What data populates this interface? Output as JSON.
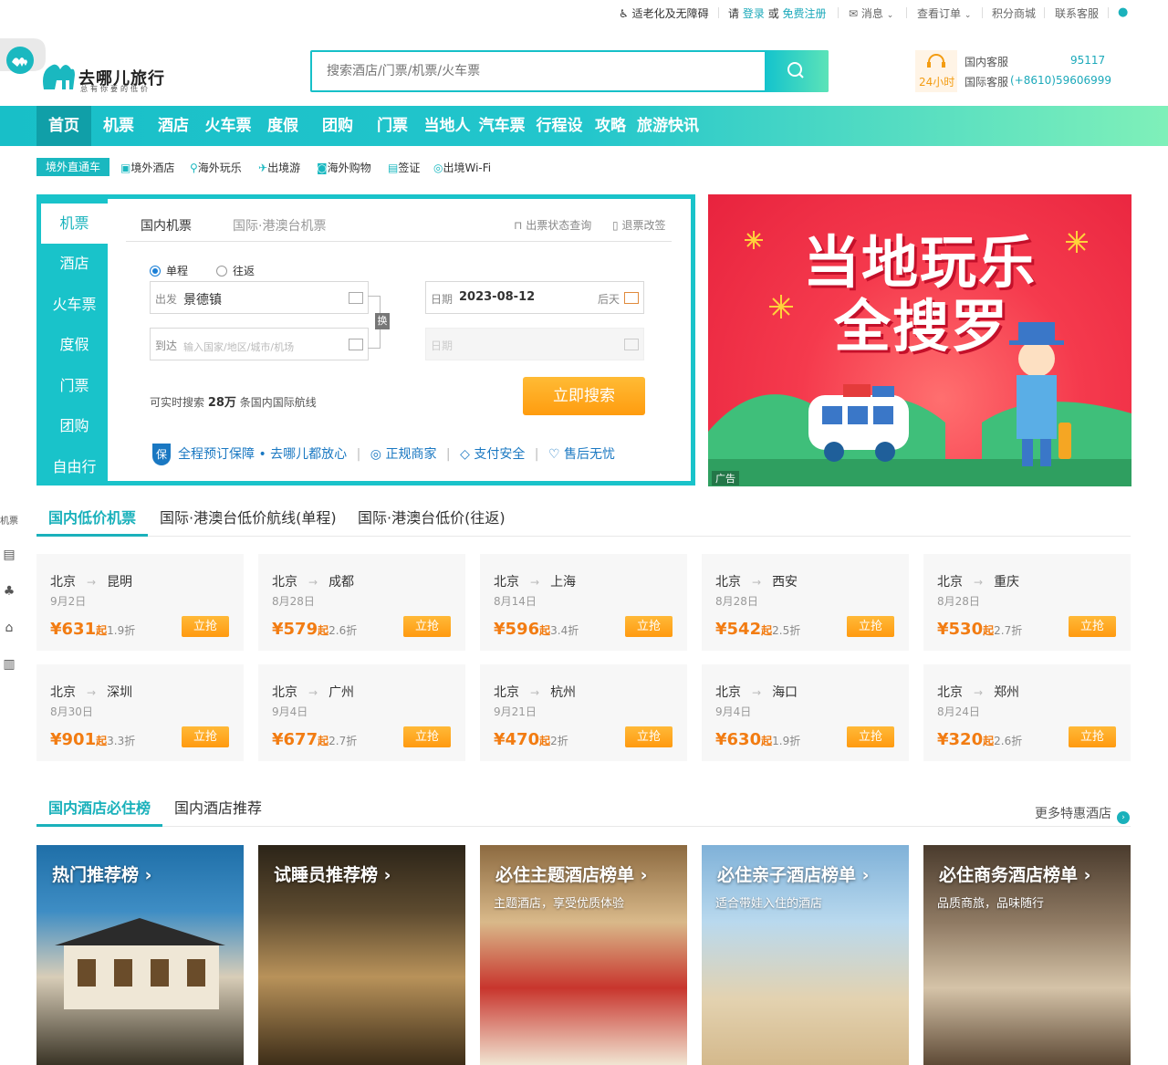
{
  "topbar": {
    "accessibility": "适老化及无障碍",
    "please": "请",
    "login": "登录",
    "or": "或",
    "register": "免费注册",
    "messages": "消息",
    "orders": "查看订单",
    "points_mall": "积分商城",
    "contact": "联系客服"
  },
  "header": {
    "logo_name": "去哪儿旅行",
    "logo_slogan": "总有你要的低价",
    "search_placeholder": "搜索酒店/门票/机票/火车票",
    "service_24h": "24小时",
    "domestic_label": "国内客服",
    "domestic_number": "95117",
    "intl_label": "国际客服",
    "intl_number": "(+8610)59606999"
  },
  "nav": [
    "首页",
    "机票",
    "酒店",
    "火车票",
    "度假",
    "团购",
    "门票",
    "当地人",
    "汽车票",
    "行程设计",
    "攻略",
    "旅游快讯"
  ],
  "subnav": {
    "tag": "境外直通车",
    "items": [
      "境外酒店",
      "海外玩乐",
      "出境游",
      "海外购物",
      "签证",
      "出境Wi-Fi"
    ]
  },
  "booking": {
    "side_tabs": [
      "机票",
      "酒店",
      "火车票",
      "度假",
      "门票",
      "团购",
      "自由行"
    ],
    "flight_tabs": [
      "国内机票",
      "国际·港澳台机票"
    ],
    "ticket_status": "出票状态查询",
    "refund": "退票改签",
    "one_way": "单程",
    "round_trip": "往返",
    "from_label": "出发",
    "from_value": "景德镇",
    "to_label": "到达",
    "to_placeholder": "输入国家/地区/城市/机场",
    "swap": "换",
    "date_label": "日期",
    "date_value": "2023-08-12",
    "date_hint": "后天",
    "return_date_label": "日期",
    "hint_prefix": "可实时搜索",
    "hint_count": "28万",
    "hint_suffix": "条国内国际航线",
    "search_button": "立即搜索",
    "guarantee_badge": "保",
    "guarantee_main": "全程预订保障 • 去哪儿都放心",
    "guarantee_items": [
      "正规商家",
      "支付安全",
      "售后无忧"
    ]
  },
  "banner": {
    "line1": "当地玩乐",
    "line2": "全搜罗",
    "ad": "广告"
  },
  "sidebar": {
    "flight": "机票"
  },
  "deals": {
    "tabs": [
      "国内低价机票",
      "国际·港澳台低价航线(单程)",
      "国际·港澳台低价(往返)"
    ],
    "qi": "起",
    "grab": "立抢",
    "items": [
      {
        "from": "北京",
        "to": "昆明",
        "date": "9月2日",
        "price": "¥631",
        "discount": "1.9折"
      },
      {
        "from": "北京",
        "to": "成都",
        "date": "8月28日",
        "price": "¥579",
        "discount": "2.6折"
      },
      {
        "from": "北京",
        "to": "上海",
        "date": "8月14日",
        "price": "¥596",
        "discount": "3.4折"
      },
      {
        "from": "北京",
        "to": "西安",
        "date": "8月28日",
        "price": "¥542",
        "discount": "2.5折"
      },
      {
        "from": "北京",
        "to": "重庆",
        "date": "8月28日",
        "price": "¥530",
        "discount": "2.7折"
      },
      {
        "from": "北京",
        "to": "深圳",
        "date": "8月30日",
        "price": "¥901",
        "discount": "3.3折"
      },
      {
        "from": "北京",
        "to": "广州",
        "date": "9月4日",
        "price": "¥677",
        "discount": "2.7折"
      },
      {
        "from": "北京",
        "to": "杭州",
        "date": "9月21日",
        "price": "¥470",
        "discount": "2折"
      },
      {
        "from": "北京",
        "to": "海口",
        "date": "9月4日",
        "price": "¥630",
        "discount": "1.9折"
      },
      {
        "from": "北京",
        "to": "郑州",
        "date": "8月24日",
        "price": "¥320",
        "discount": "2.6折"
      }
    ]
  },
  "hotels": {
    "tabs": [
      "国内酒店必住榜",
      "国内酒店推荐"
    ],
    "more": "更多特惠酒店",
    "items": [
      {
        "title": "热门推荐榜 ›",
        "sub": ""
      },
      {
        "title": "试睡员推荐榜 ›",
        "sub": ""
      },
      {
        "title": "必住主题酒店榜单 ›",
        "sub": "主题酒店，享受优质体验"
      },
      {
        "title": "必住亲子酒店榜单 ›",
        "sub": "适合带娃入住的酒店"
      },
      {
        "title": "必住商务酒店榜单 ›",
        "sub": "品质商旅，品味随行"
      }
    ]
  },
  "colors": {
    "brand": "#19c3ca",
    "accent_orange": "#ff9c0f",
    "price": "#f27c12"
  }
}
